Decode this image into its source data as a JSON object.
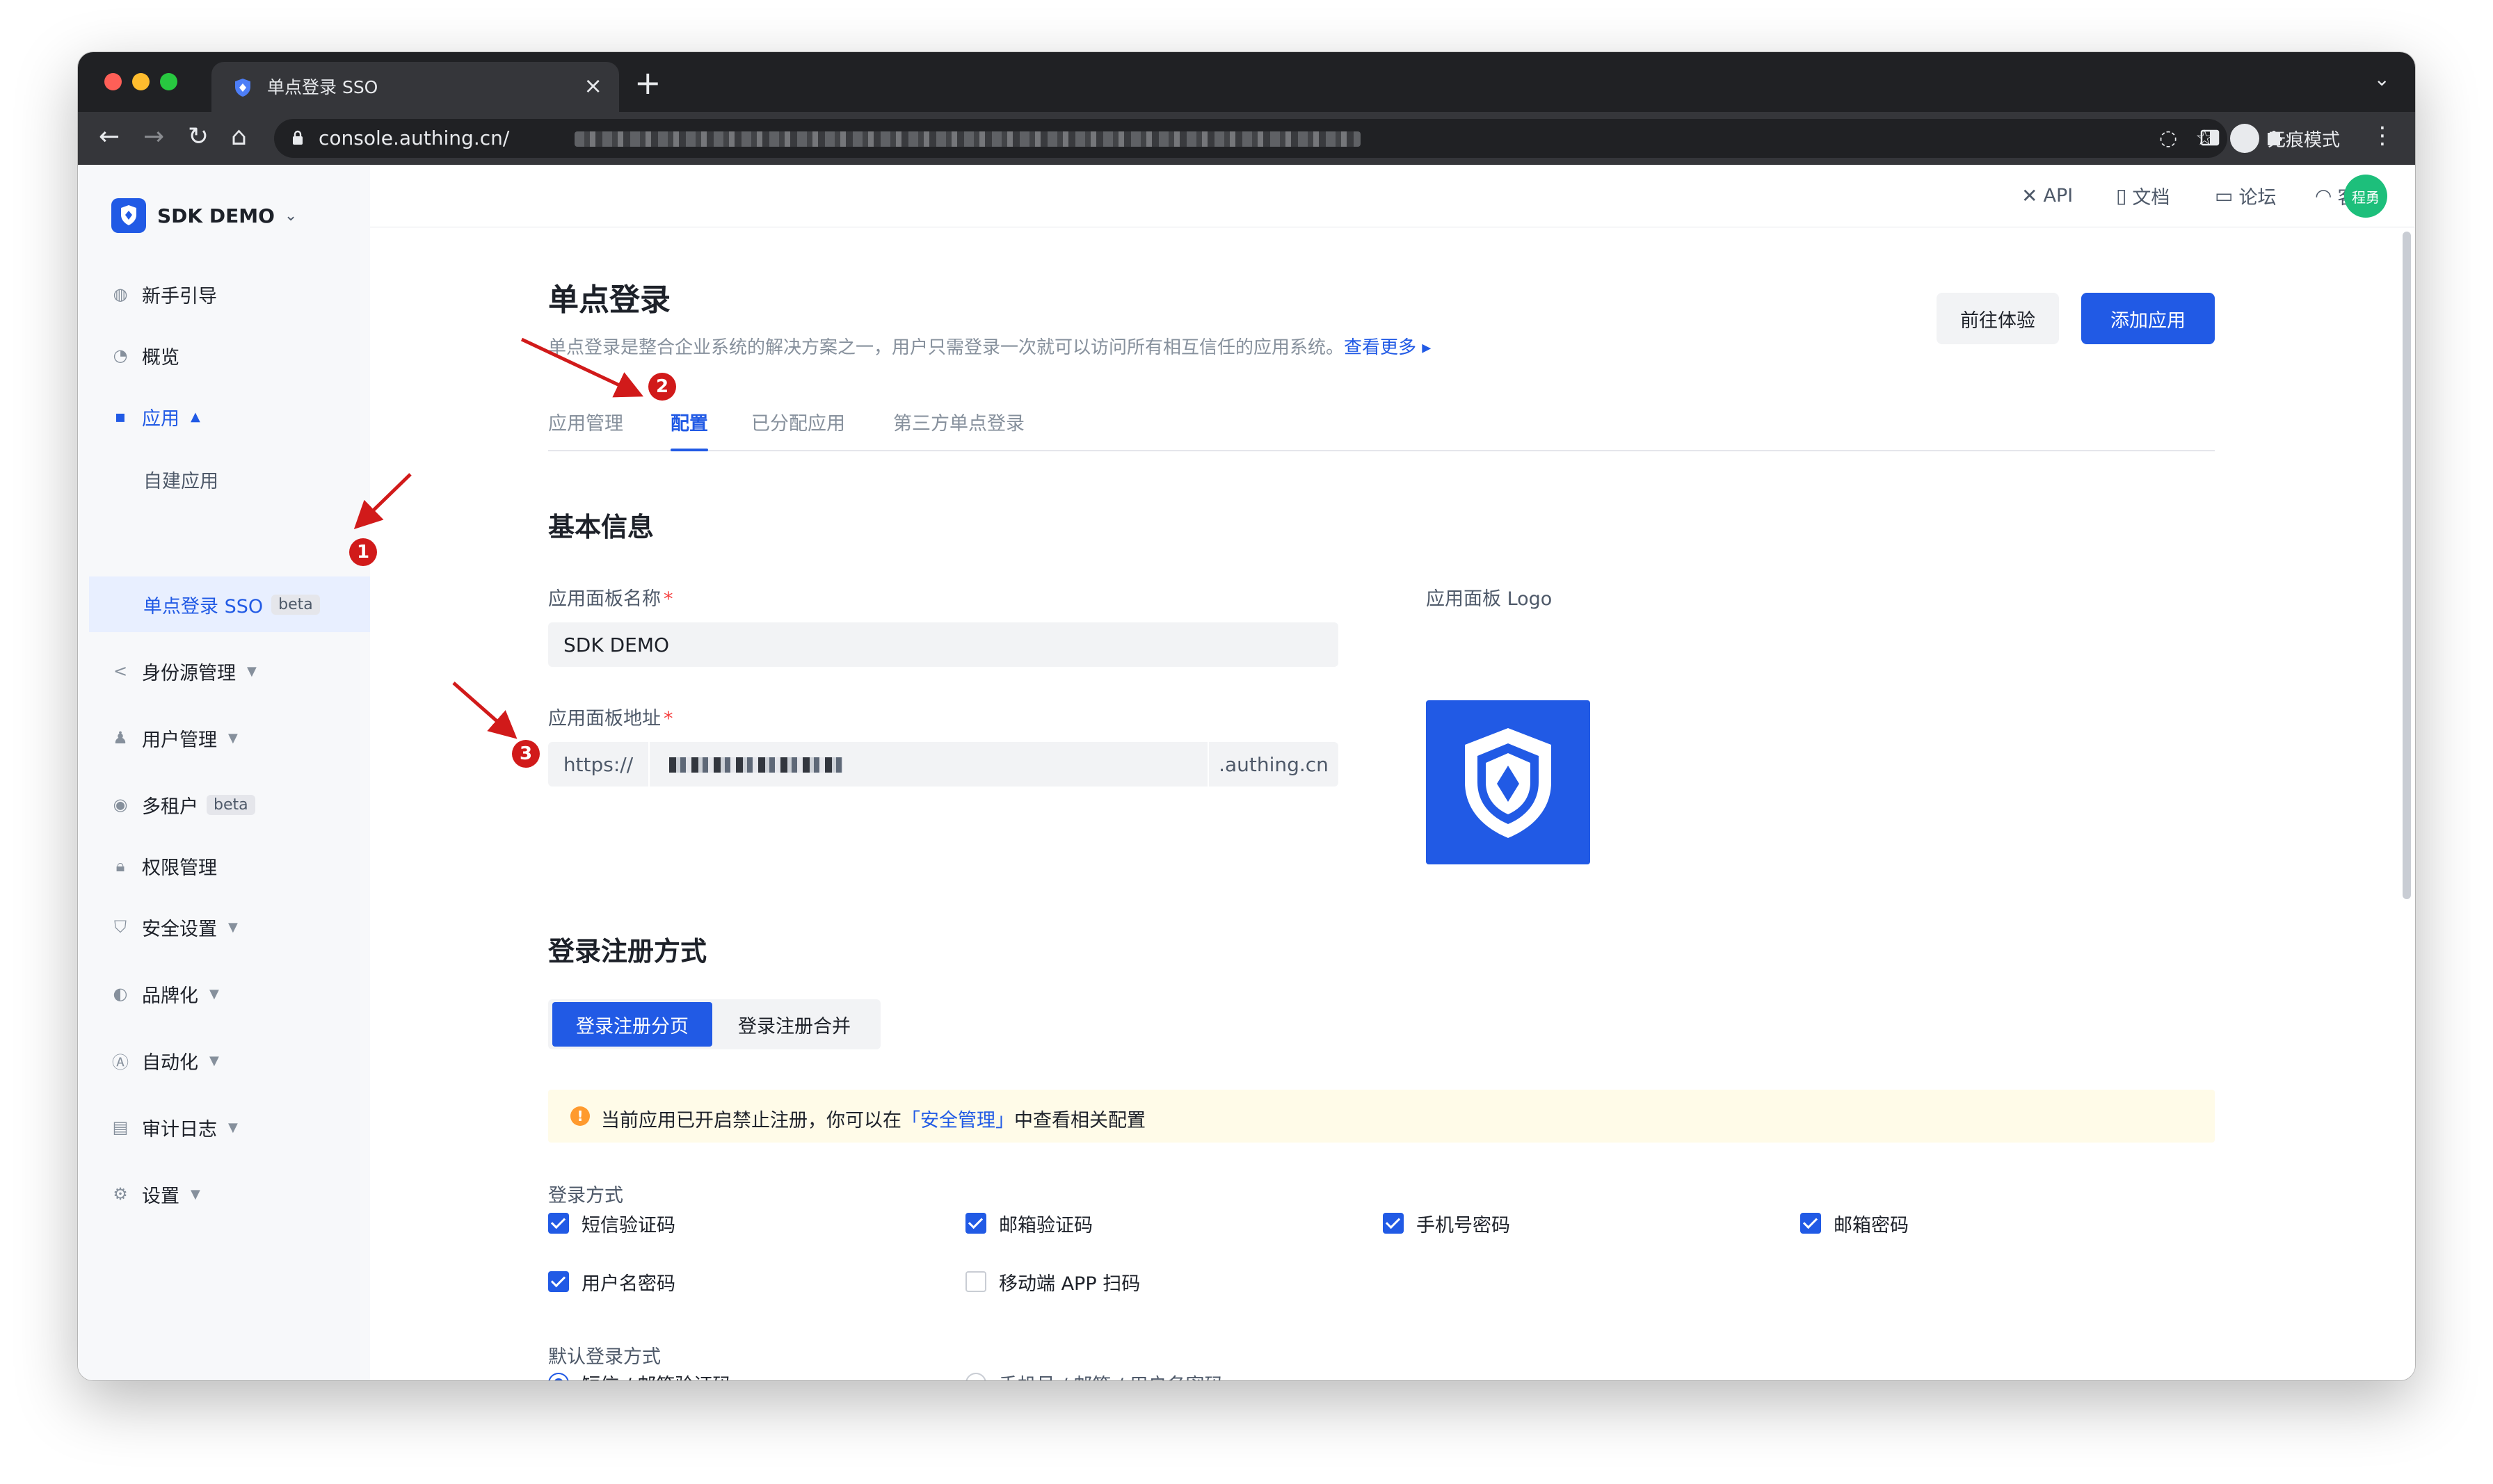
{
  "browser": {
    "tab_title": "单点登录 SSO",
    "url": "console.authing.cn/",
    "incognito_label": "无痕模式"
  },
  "sidebar": {
    "app_name": "SDK DEMO",
    "items": [
      {
        "label": "新手引导"
      },
      {
        "label": "概览"
      },
      {
        "label": "应用"
      },
      {
        "label": "身份源管理"
      },
      {
        "label": "用户管理"
      },
      {
        "label": "多租户",
        "badge": "beta"
      },
      {
        "label": "权限管理"
      },
      {
        "label": "安全设置"
      },
      {
        "label": "品牌化"
      },
      {
        "label": "自动化"
      },
      {
        "label": "审计日志"
      },
      {
        "label": "设置"
      }
    ],
    "sub_items": [
      {
        "label": "自建应用"
      },
      {
        "label": "单点登录 SSO",
        "badge": "beta"
      }
    ]
  },
  "topbar": {
    "links": [
      {
        "label": "API"
      },
      {
        "label": "文档"
      },
      {
        "label": "论坛"
      },
      {
        "label": "客服"
      }
    ],
    "avatar": "程勇"
  },
  "page": {
    "title": "单点登录",
    "description": "单点登录是整合企业系统的解决方案之一，用户只需登录一次就可以访问所有相互信任的应用系统。",
    "more_link": "查看更多 ▸",
    "btn_try": "前往体验",
    "btn_add": "添加应用",
    "tabs": [
      {
        "label": "应用管理"
      },
      {
        "label": "配置"
      },
      {
        "label": "已分配应用"
      },
      {
        "label": "第三方单点登录"
      }
    ]
  },
  "basic": {
    "title": "基本信息",
    "panel_name_label": "应用面板名称",
    "panel_name_value": "SDK DEMO",
    "panel_addr_label": "应用面板地址",
    "addr_prefix": "https://",
    "addr_suffix": ".authing.cn",
    "logo_label": "应用面板 Logo",
    "required_mark": "*"
  },
  "login": {
    "title": "登录注册方式",
    "segments": [
      "登录注册分页",
      "登录注册合并"
    ],
    "alert_prefix": "当前应用已开启禁止注册，你可以在",
    "alert_link": "「安全管理」",
    "alert_suffix": "中查看相关配置",
    "methods_label": "登录方式",
    "methods": [
      {
        "label": "短信验证码",
        "checked": true
      },
      {
        "label": "邮箱验证码",
        "checked": true
      },
      {
        "label": "手机号密码",
        "checked": true
      },
      {
        "label": "邮箱密码",
        "checked": true
      },
      {
        "label": "用户名密码",
        "checked": true
      },
      {
        "label": "移动端 APP 扫码",
        "checked": false
      }
    ],
    "default_label": "默认登录方式",
    "defaults": [
      {
        "label": "短信 / 邮箱验证码",
        "selected": true
      },
      {
        "label": "手机号 / 邮箱 / 用户名密码",
        "selected": false
      }
    ]
  },
  "annotations": [
    "1",
    "2",
    "3"
  ],
  "colors": {
    "accent": "#215ae5",
    "annotation": "#d11a1a",
    "alert_bg": "#fffbe8"
  }
}
